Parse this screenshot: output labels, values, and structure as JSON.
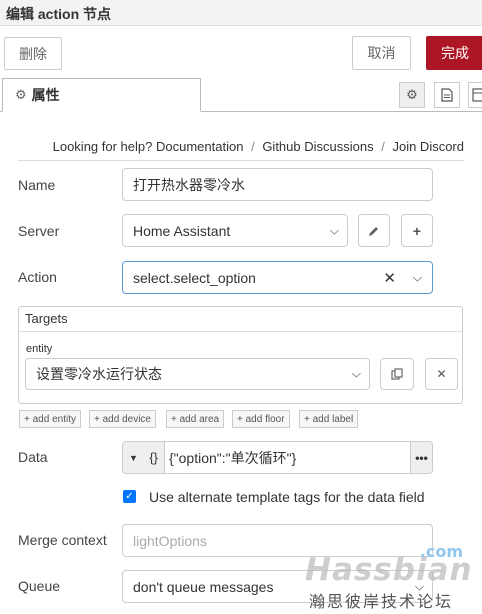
{
  "title": "编辑 action 节点",
  "toolbar": {
    "delete_label": "删除",
    "cancel_label": "取消",
    "done_label": "完成"
  },
  "tabs": {
    "properties_label": "属性"
  },
  "help": {
    "prefix": "Looking for help?",
    "documentation": "Documentation",
    "sep": "/",
    "github": "Github Discussions",
    "discord": "Join Discord"
  },
  "form": {
    "name_label": "Name",
    "name_value": "打开热水器零冷水",
    "server_label": "Server",
    "server_value": "Home Assistant",
    "action_label": "Action",
    "action_value": "select.select_option",
    "targets_label": "Targets",
    "entity_label": "entity",
    "entity_value": "设置零冷水运行状态",
    "add_buttons": [
      "+ add entity",
      "+ add device",
      "+ add area",
      "+ add floor",
      "+ add label"
    ],
    "data_label": "Data",
    "data_type": "{}",
    "data_value": "{\"option\":\"单次循环\"}",
    "alt_tags_label": "Use alternate template tags for the data field",
    "alt_tags_checked": true,
    "merge_label": "Merge context",
    "merge_placeholder": "lightOptions",
    "queue_label": "Queue",
    "queue_value": "don't queue messages"
  },
  "watermark": {
    "com": ".com",
    "main": "Hassbian",
    "sub": "瀚思彼岸技术论坛"
  },
  "icons": {
    "gear": "gear-icon",
    "pencil": "pencil-icon",
    "plus": "plus-icon",
    "clear": "clear-icon",
    "chevron": "chevron-down-icon",
    "copy": "copy-icon",
    "close": "close-icon"
  }
}
